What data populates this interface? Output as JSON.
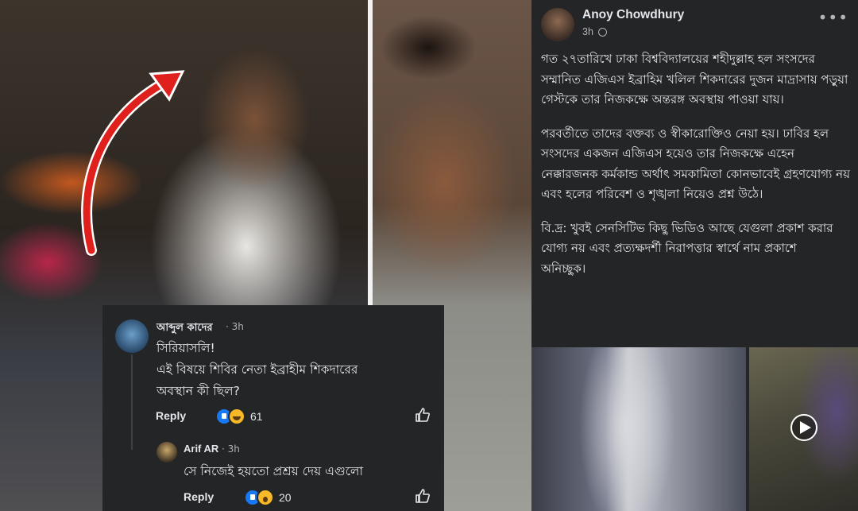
{
  "post": {
    "author": "Anoy Chowdhury",
    "time": "3h",
    "more": "•••",
    "paragraphs": [
      "গত ২৭তারিখে ঢাকা বিশ্ববিদ্যালয়ের শহীদুল্লাহ হল সংসদের সম্মানিত এজিএস ইব্রাহিম খলিল শিকদারের দুজন মাদ্রাসায় পড়ুয়া গেস্টকে তার নিজকক্ষে অন্তরঙ্গ অবস্থায় পাওয়া যায়।",
      "পরবর্তীতে তাদের বক্তব্য ও স্বীকারোক্তিও নেয়া হয়। ঢাবির হল সংসদের একজন এজিএস হয়েও তার নিজকক্ষে এহেন নেক্কারজনক কর্মকান্ড অর্থাৎ সমকামিতা কোনভাবেই গ্রহণযোগ্য নয় এবং হলের পরিবেশ ও শৃঙ্খলা নিয়েও প্রশ্ন উঠে।",
      "বি.দ্র: খুবই সেনসিটিভ কিছু ভিডিও আছে যেগুলা প্রকাশ করার যোগ্য নয় এবং প্রত্যক্ষদর্শী নিরাপত্তার স্বার্থে নাম প্রকাশে",
      "অনিচ্ছুক।"
    ]
  },
  "comments": [
    {
      "name": "আব্দুল কাদের",
      "time": "· 3h",
      "lines": [
        "সিরিয়াসলি!",
        "এই বিষয়ে শিবির নেতা ইব্রাহীম শিকদারের",
        "অবস্থান কী ছিল?"
      ],
      "reply_label": "Reply",
      "reaction_count": "61"
    },
    {
      "name": "Arif AR",
      "time": "· 3h",
      "lines": [
        "সে নিজেই হয়তো প্রশ্রয় দেয় এগুলো"
      ],
      "reply_label": "Reply",
      "reaction_count": "20"
    }
  ],
  "colors": {
    "panel": "#242526",
    "text": "#e4e6eb",
    "secondary": "#b0b3b8",
    "arrow": "#e0201c",
    "like": "#1877f2"
  }
}
